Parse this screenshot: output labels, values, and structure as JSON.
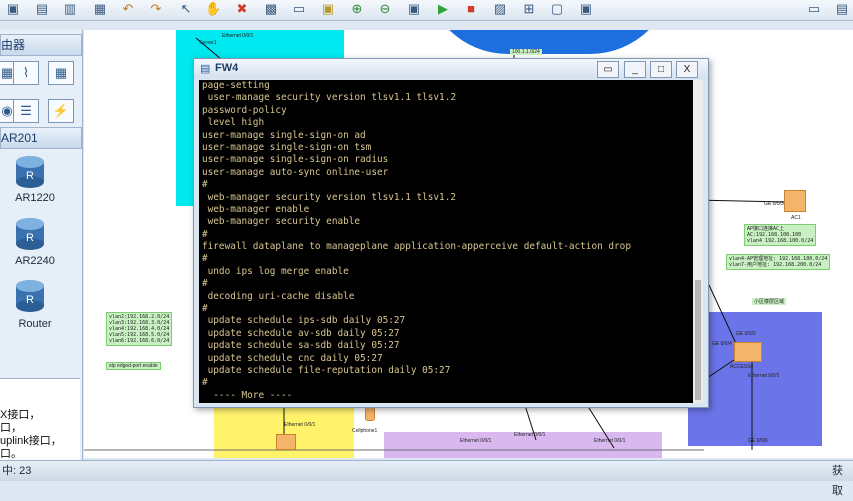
{
  "toolbar": {
    "icons": [
      "open-icon",
      "save-icon",
      "save-as-icon",
      "print-icon",
      "undo-icon",
      "redo-icon",
      "select-icon",
      "hand-icon",
      "delete-icon",
      "clear-icon",
      "text-icon",
      "palette-icon",
      "zoom-in-icon",
      "zoom-out-icon",
      "topology-icon",
      "start-icon",
      "stop-icon",
      "capture-icon",
      "plus-icon",
      "console-icon",
      "settings-icon",
      "chat-icon",
      "menu-icon"
    ]
  },
  "left_panel": {
    "category_title": "由器",
    "section_title": "AR201",
    "devices": [
      {
        "label": "AR1220"
      },
      {
        "label": "AR2240"
      },
      {
        "label": "Router"
      }
    ],
    "description_lines": [
      "X接口，",
      "口，",
      "uplink接口，",
      "口。"
    ]
  },
  "canvas": {
    "labels": {
      "server1": "Server1",
      "ethernet_top": "Ethernet 0/0/1",
      "subnet_top": "100.1.1.0/24",
      "ac1": "AC1",
      "ge003": "GE 0/0/3",
      "ac_note": "AP接口连接AC上\nAC:192.168.100.100\nvlan4 192.168.100.0/24",
      "vlan_note": "vlan4-AP管理地址: 192.168.100.0/24\nvlan7-用户地址: 192.168.200.0/24",
      "small_area": "小区楼层区域",
      "left_note": "vlan2:192.168.2.0/24\nvlan3:192.168.3.0/24\nvlan4:192.168.4.0/24\nvlan5:192.168.5.0/24\nvlan6:192.168.6.0/24",
      "stp_note": "stp edged-port enable",
      "access4": "ACCESS4",
      "ge0104": "GE 0/0/4",
      "ge0102": "GE 0/0/2",
      "eth_a": "Ethernet 0/0/1",
      "eth_b": "Ethernet 0/0/1",
      "eth_c": "Ethernet 0/0/1",
      "eth_d": "Ethernet 0/0/1",
      "eth_e": "Ethernet 0/0/1",
      "ge006": "GE 0/0/6",
      "cellphone": "Cellphone1"
    }
  },
  "fw_window": {
    "title": "FW4",
    "buttons": {
      "console": "▭",
      "minimize": "_",
      "maximize": "□",
      "close": "X"
    },
    "lines": [
      "page-setting",
      " user-manage security version tlsv1.1 tlsv1.2",
      "password-policy",
      " level high",
      "user-manage single-sign-on ad",
      "user-manage single-sign-on tsm",
      "user-manage single-sign-on radius",
      "user-manage auto-sync online-user",
      "#",
      " web-manager security version tlsv1.1 tlsv1.2",
      " web-manager enable",
      " web-manager security enable",
      "#",
      "firewall dataplane to manageplane application-apperceive default-action drop",
      "#",
      " undo ips log merge enable",
      "#",
      " decoding uri-cache disable",
      "#",
      " update schedule ips-sdb daily 05:27",
      " update schedule av-sdb daily 05:27",
      " update schedule sa-sdb daily 05:27",
      " update schedule cnc daily 05:27",
      " update schedule file-reputation daily 05:27",
      "#",
      "  ---- More ----"
    ]
  },
  "status_bar": {
    "left": "中: 23",
    "right": "获取"
  }
}
